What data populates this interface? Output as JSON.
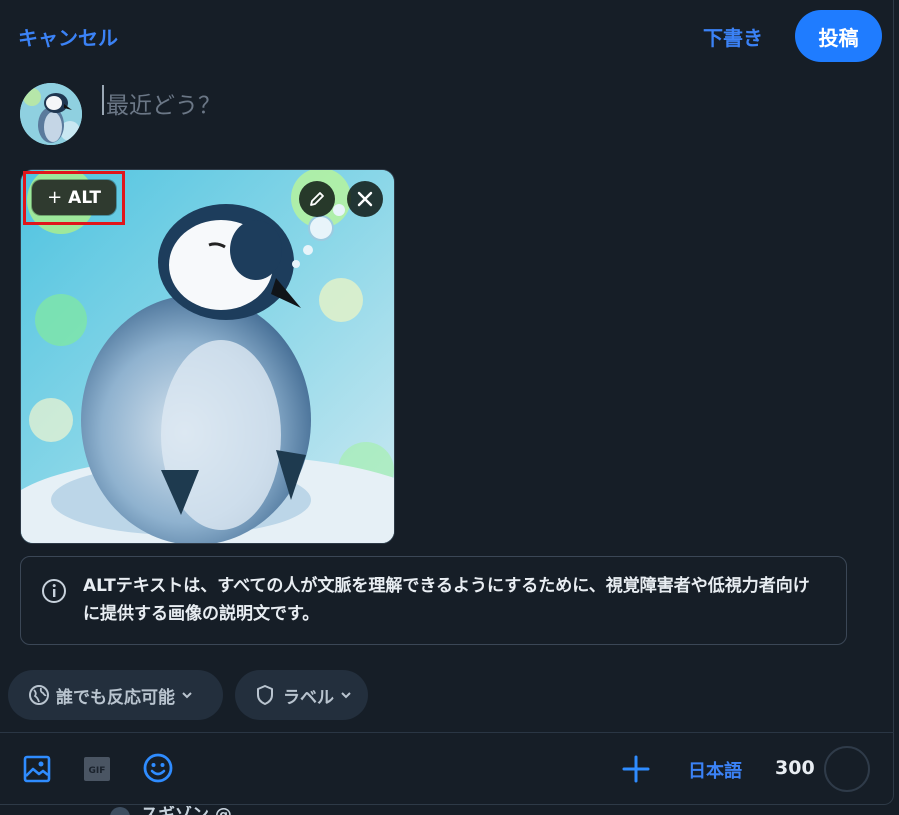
{
  "header": {
    "cancel_label": "キャンセル",
    "draft_label": "下書き",
    "post_label": "投稿"
  },
  "composer": {
    "placeholder": "最近どう？"
  },
  "image": {
    "alt_button_label": "ALT",
    "alt_plus": "+"
  },
  "info": {
    "text": "ALTテキストは、すべての人が文脈を理解できるようにするために、視覚障害者や低視力者向けに提供する画像の説明文です。"
  },
  "settings": {
    "reply_label": "誰でも反応可能",
    "label_label": "ラベル"
  },
  "toolbar": {
    "language": "日本語",
    "char_count": "300"
  },
  "behind": {
    "text": "スギゾン @"
  },
  "colors": {
    "accent": "#1f7cff",
    "link": "#3b82f6",
    "background": "#161e27",
    "highlight": "#e0151b"
  },
  "icons": [
    "image-icon",
    "gif-icon",
    "emoji-icon",
    "plus-icon",
    "info-icon",
    "globe-icon",
    "shield-icon",
    "chevron-down-icon",
    "pencil-icon",
    "close-icon"
  ]
}
